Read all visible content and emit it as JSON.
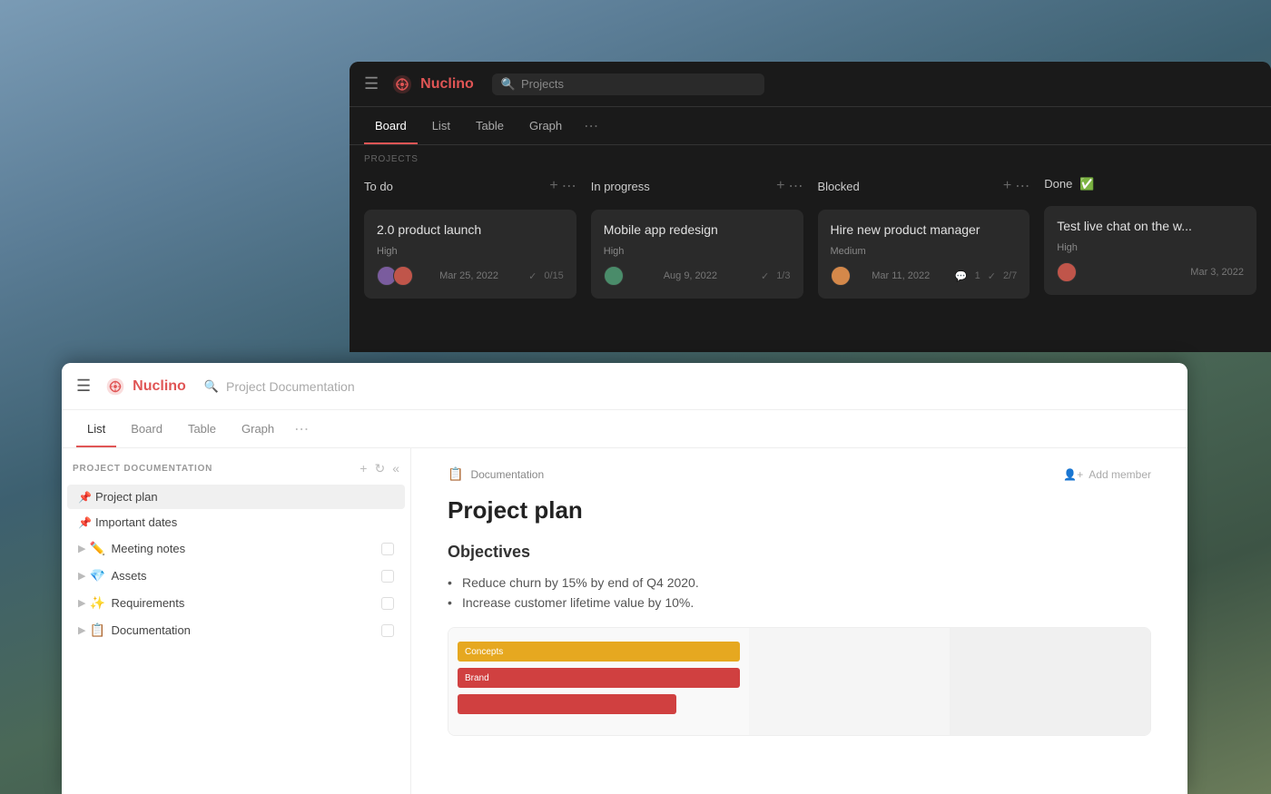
{
  "background": {
    "color": "#6b8c7a"
  },
  "top_panel": {
    "logo_text": "Nuclino",
    "search_placeholder": "Projects",
    "section_label": "PROJECTS",
    "tabs": [
      {
        "id": "board",
        "label": "Board",
        "active": true
      },
      {
        "id": "list",
        "label": "List",
        "active": false
      },
      {
        "id": "table",
        "label": "Table",
        "active": false
      },
      {
        "id": "graph",
        "label": "Graph",
        "active": false
      }
    ],
    "columns": [
      {
        "id": "todo",
        "title": "To do",
        "cards": [
          {
            "title": "2.0 product launch",
            "priority": "High",
            "date": "Mar 25, 2022",
            "progress": "0/15",
            "avatars": [
              "a1",
              "a2"
            ]
          }
        ]
      },
      {
        "id": "in_progress",
        "title": "In progress",
        "cards": [
          {
            "title": "Mobile app redesign",
            "priority": "High",
            "date": "Aug 9, 2022",
            "progress": "1/3",
            "avatars": [
              "a3"
            ]
          }
        ]
      },
      {
        "id": "blocked",
        "title": "Blocked",
        "cards": [
          {
            "title": "Hire new product manager",
            "priority": "Medium",
            "date": "Mar 11, 2022",
            "comments": "1",
            "progress": "2/7",
            "avatars": [
              "a4"
            ]
          }
        ]
      },
      {
        "id": "done",
        "title": "Done",
        "title_emoji": "✅",
        "cards": [
          {
            "title": "Test live chat on the w...",
            "priority": "High",
            "date": "Mar 3, 2022",
            "avatars": [
              "a2"
            ]
          }
        ]
      }
    ]
  },
  "bottom_panel": {
    "logo_text": "Nuclino",
    "search_placeholder": "Project Documentation",
    "tabs": [
      {
        "id": "list",
        "label": "List",
        "active": true
      },
      {
        "id": "board",
        "label": "Board",
        "active": false
      },
      {
        "id": "table",
        "label": "Table",
        "active": false
      },
      {
        "id": "graph",
        "label": "Graph",
        "active": false
      }
    ],
    "sidebar": {
      "section_label": "PROJECT DOCUMENTATION",
      "items": [
        {
          "id": "project-plan",
          "label": "Project plan",
          "pinned": true,
          "emoji": ""
        },
        {
          "id": "important-dates",
          "label": "Important dates",
          "pinned": true,
          "emoji": ""
        },
        {
          "id": "meeting-notes",
          "label": "Meeting notes",
          "pinned": false,
          "emoji": "✏️",
          "expandable": true
        },
        {
          "id": "assets",
          "label": "Assets",
          "pinned": false,
          "emoji": "💎",
          "expandable": true
        },
        {
          "id": "requirements",
          "label": "Requirements",
          "pinned": false,
          "emoji": "✨",
          "expandable": true
        },
        {
          "id": "documentation",
          "label": "Documentation",
          "pinned": false,
          "emoji": "📋",
          "expandable": true
        }
      ]
    },
    "main": {
      "breadcrumb": "Documentation",
      "breadcrumb_icon": "📋",
      "add_member_label": "Add member",
      "doc_title": "Project plan",
      "section_title": "Objectives",
      "bullets": [
        "Reduce churn by 15% by end of Q4 2020.",
        "Increase customer lifetime value by 10%."
      ],
      "chart": {
        "bars": [
          {
            "label": "Concepts",
            "color": "#e6a820"
          },
          {
            "label": "Brand",
            "color": "#d04040"
          }
        ]
      }
    }
  }
}
